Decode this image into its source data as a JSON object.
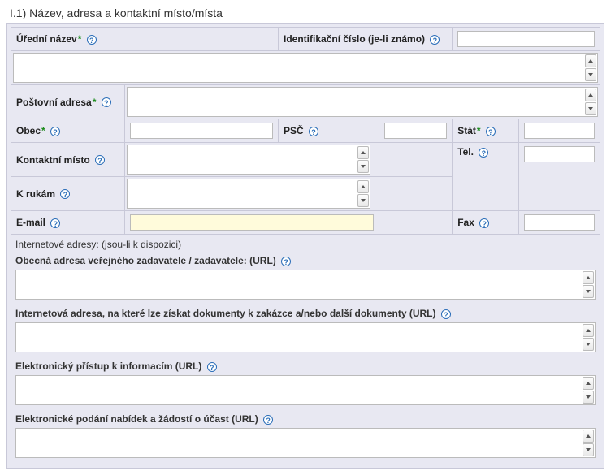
{
  "section_title": "I.1) Název, adresa a kontaktní místo/místa",
  "labels": {
    "official_name": "Úřední název",
    "id_number": "Identifikační číslo (je-li známo)",
    "postal_address": "Poštovní adresa",
    "city": "Obec",
    "postal_code": "PSČ",
    "state": "Stát",
    "contact_point": "Kontaktní místo",
    "tel": "Tel.",
    "attention": "K rukám",
    "email": "E-mail",
    "fax": "Fax"
  },
  "internet_heading": "Internetové adresy: (jsou-li k dispozici)",
  "urls": {
    "general": "Obecná adresa veřejného zadavatele / zadavatele: (URL)",
    "documents": "Internetová adresa, na které lze získat dokumenty k zakázce a/nebo další dokumenty (URL)",
    "electronic_access": "Elektronický přístup k informacím (URL)",
    "electronic_submission": "Elektronické podání nabídek a žádostí o účast (URL)"
  },
  "values": {
    "official_name": "",
    "id_number": "",
    "postal_address": "",
    "city": "",
    "postal_code": "",
    "state": "",
    "contact_point": "",
    "tel": "",
    "attention": "",
    "email": "",
    "fax": "",
    "url_general": "",
    "url_documents": "",
    "url_electronic_access": "",
    "url_electronic_submission": ""
  }
}
